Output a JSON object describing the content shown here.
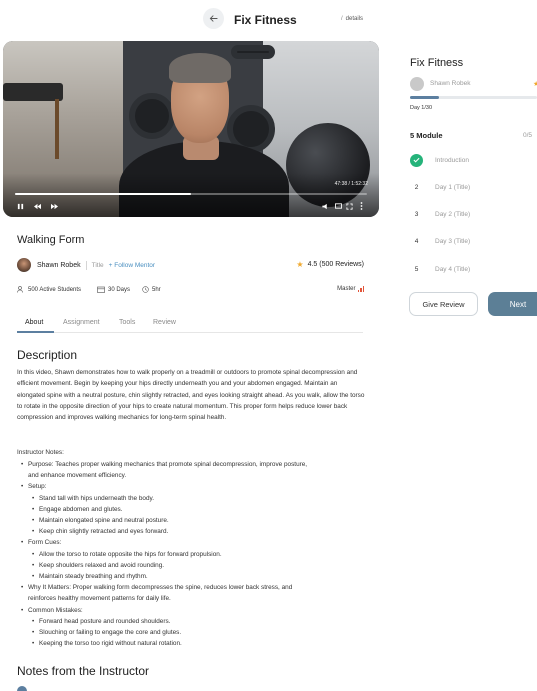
{
  "header": {
    "title": "Fix Fitness",
    "breadcrumb_sep": "/",
    "breadcrumb": "details"
  },
  "video": {
    "time": "47:38 / 1:52:32",
    "progress_fraction": 0.5
  },
  "course": {
    "title": "Walking Form",
    "mentor_name": "Shawn Robek",
    "mentor_role": "Title",
    "follow_label": "+ Follow Mentor",
    "rating": "4.5 (500 Reviews)",
    "students": "500 Active Students",
    "duration_days": "30 Days",
    "duration_hours": "5hr",
    "level": "Master"
  },
  "tabs": [
    "About",
    "Assignment",
    "Tools",
    "Review"
  ],
  "description": {
    "heading": "Description",
    "paragraph": "In this video, Shawn demonstrates how to walk properly on a treadmill or outdoors to promote spinal decompression and efficient movement. Begin by keeping your hips directly underneath you and your abdomen engaged. Maintain an elongated spine with a neutral posture, chin slightly retracted, and eyes looking straight ahead. As you walk, allow the torso to rotate in the opposite direction of your hips to create natural momentum. This proper form helps reduce lower back compression and improves walking mechanics for long-term spinal health.",
    "notes_label": "Instructor Notes:",
    "outline": [
      {
        "level": 1,
        "text": "Purpose: Teaches proper walking mechanics that promote spinal decompression, improve posture,"
      },
      {
        "level": 0,
        "text": "and enhance movement efficiency."
      },
      {
        "level": 1,
        "text": "Setup:"
      },
      {
        "level": 2,
        "text": "Stand tall with hips underneath the body."
      },
      {
        "level": 2,
        "text": "Engage abdomen and glutes."
      },
      {
        "level": 2,
        "text": "Maintain elongated spine and neutral posture."
      },
      {
        "level": 2,
        "text": "Keep chin slightly retracted and eyes forward."
      },
      {
        "level": 1,
        "text": "Form Cues:"
      },
      {
        "level": 2,
        "text": "Allow the torso to rotate opposite the hips for forward propulsion."
      },
      {
        "level": 2,
        "text": "Keep shoulders relaxed and avoid rounding."
      },
      {
        "level": 2,
        "text": "Maintain steady breathing and rhythm."
      },
      {
        "level": 1,
        "text": "Why It Matters: Proper walking form decompresses the spine, reduces lower back stress, and"
      },
      {
        "level": 0,
        "text": "reinforces healthy movement patterns for daily life."
      },
      {
        "level": 1,
        "text": "Common Mistakes:"
      },
      {
        "level": 2,
        "text": "Forward head posture and rounded shoulders."
      },
      {
        "level": 2,
        "text": "Slouching or failing to engage the core and glutes."
      },
      {
        "level": 2,
        "text": "Keeping the torso too rigid without natural rotation."
      }
    ],
    "notes_heading": "Notes from the Instructor"
  },
  "panel": {
    "title": "Fix Fitness",
    "mentor": "Shawn Robek",
    "progress_fraction": 0.23,
    "day": "Day 1/30",
    "modules": "5 Module",
    "count": "0/5",
    "items": [
      {
        "kind": "check",
        "label": "Introduction"
      },
      {
        "kind": "num",
        "num": "2",
        "label": "Day 1 (Title)"
      },
      {
        "kind": "num",
        "num": "3",
        "label": "Day 2 (Title)"
      },
      {
        "kind": "num",
        "num": "4",
        "label": "Day 3 (Title)"
      },
      {
        "kind": "num",
        "num": "5",
        "label": "Day 4 (Title)"
      }
    ],
    "review_label": "Give Review",
    "next_label": "Next"
  },
  "colors": {
    "accent": "#5c7fa0",
    "success": "#25b37a",
    "star": "#f0a92e",
    "level_bars": "#e2553a"
  }
}
